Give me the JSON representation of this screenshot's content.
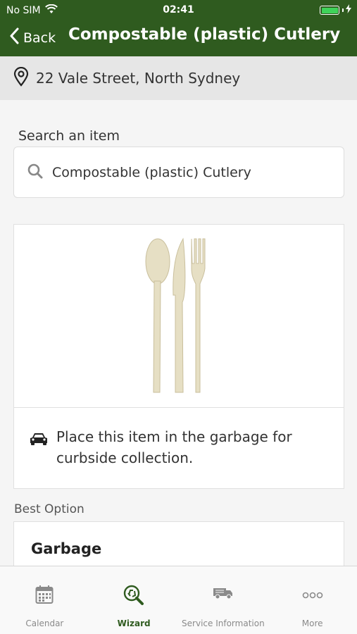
{
  "status_bar": {
    "carrier": "No SIM",
    "time": "02:41",
    "battery_level": 1.0
  },
  "nav": {
    "back_label": "Back",
    "title": "Compostable (plastic) Cutlery"
  },
  "address": {
    "text": "22 Vale Street, North Sydney"
  },
  "search": {
    "label": "Search an item",
    "value": "Compostable (plastic) Cutlery"
  },
  "item_card": {
    "instruction": "Place this item in the garbage for curbside collection."
  },
  "best_option": {
    "label": "Best Option",
    "title": "Garbage"
  },
  "tabs": [
    {
      "label": "Calendar",
      "icon": "calendar-icon"
    },
    {
      "label": "Wizard",
      "icon": "recycle-search-icon",
      "active": true
    },
    {
      "label": "Service Information",
      "icon": "truck-icon"
    },
    {
      "label": "More",
      "icon": "more-icon"
    }
  ],
  "colors": {
    "brand_green": "#2f5b1f",
    "battery_green": "#3fd35a",
    "inactive_tab": "#8a8a8a"
  }
}
